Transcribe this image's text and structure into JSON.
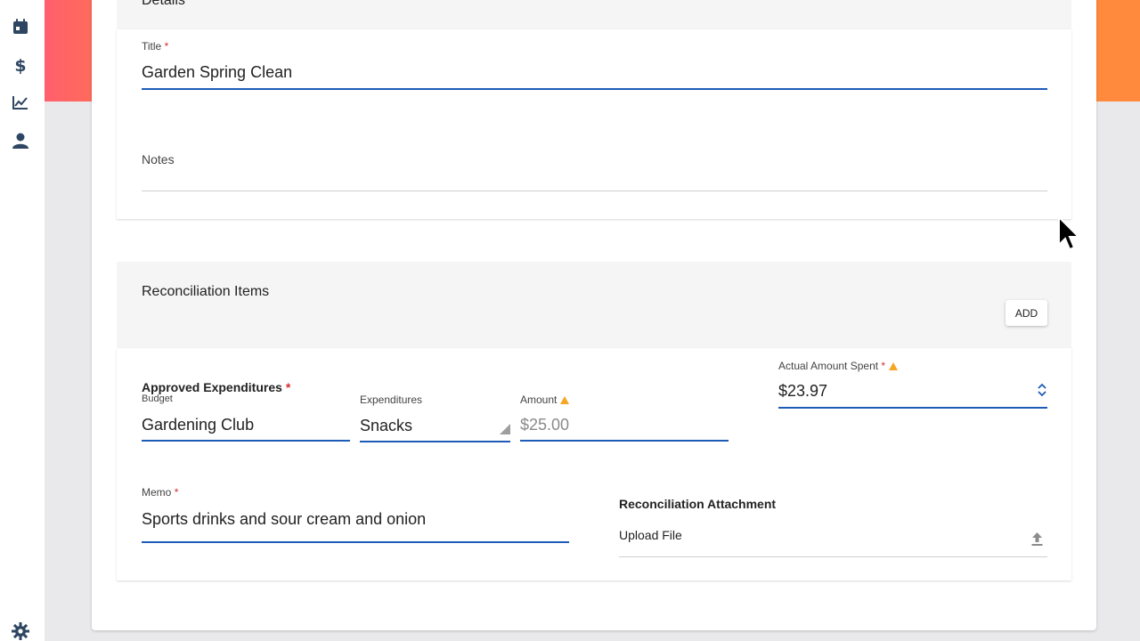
{
  "nav": {
    "icons": [
      "calendar-icon",
      "dollar-icon",
      "chart-line-icon",
      "person-icon"
    ],
    "settings_icon": "gear-icon"
  },
  "details": {
    "section_title": "Details",
    "title_label": "Title",
    "title_value": "Garden Spring Clean",
    "notes_label": "Notes",
    "notes_value": ""
  },
  "reconciliation": {
    "section_title": "Reconciliation Items",
    "add_label": "ADD",
    "approved_label": "Approved Expenditures",
    "budget_label": "Budget",
    "budget_value": "Gardening Club",
    "expenditures_label": "Expenditures",
    "expenditures_value": "Snacks",
    "amount_label": "Amount",
    "amount_value": "$25.00",
    "actual_label": "Actual Amount Spent",
    "actual_value": "$23.97",
    "memo_label": "Memo",
    "memo_value": "Sports drinks and sour cream and onion",
    "attachment_label": "Reconciliation Attachment",
    "upload_label": "Upload File"
  },
  "required_marker": "*",
  "colors": {
    "accent": "#1e5bb8",
    "required": "#d32f2f",
    "warning": "#f5a623",
    "band_left": "#ff5f6d",
    "band_right": "#ff8a3d",
    "nav_icon": "#2f4662"
  }
}
